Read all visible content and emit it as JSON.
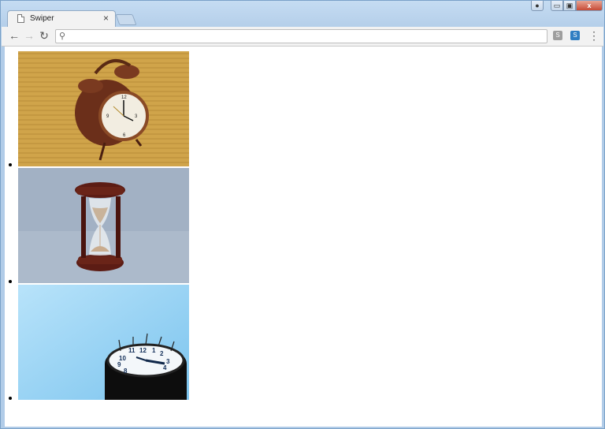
{
  "browser": {
    "tab_title": "Swiper",
    "tab_close": "×",
    "window_close": "x",
    "window_min": "▭",
    "window_max": "▣",
    "address_value": "",
    "ext1_label": "S",
    "ext2_label": "S"
  },
  "slides": [
    {
      "label": "alarm-clock"
    },
    {
      "label": "hourglass"
    },
    {
      "label": "wall-clock"
    }
  ],
  "colors": {
    "wood": "#c79a3a",
    "hourglass_bg": "#9fb0c4",
    "sky": "#8ed0f4"
  }
}
